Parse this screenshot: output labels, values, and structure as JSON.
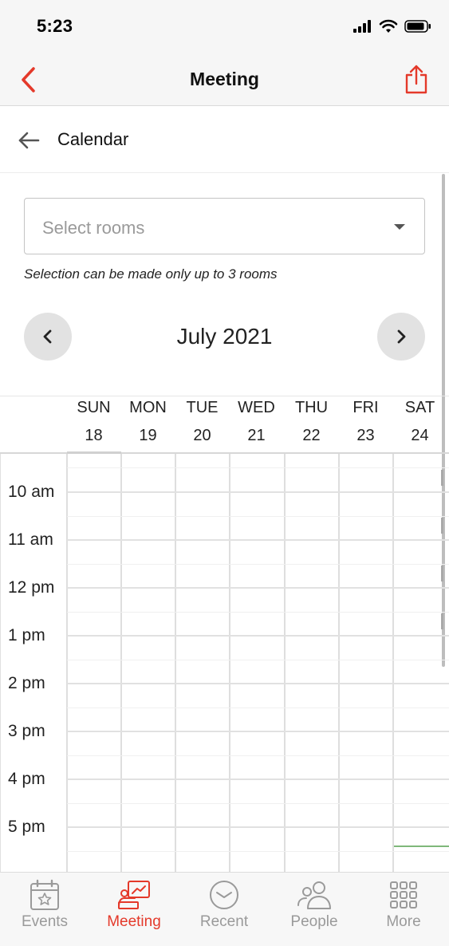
{
  "status_bar": {
    "time": "5:23"
  },
  "nav": {
    "title": "Meeting"
  },
  "sub_header": {
    "title": "Calendar"
  },
  "room_select": {
    "placeholder": "Select rooms",
    "hint": "Selection can be made only up to 3 rooms"
  },
  "calendar": {
    "month_label": "July 2021",
    "days": [
      {
        "name": "SUN",
        "num": "18"
      },
      {
        "name": "MON",
        "num": "19"
      },
      {
        "name": "TUE",
        "num": "20"
      },
      {
        "name": "WED",
        "num": "21"
      },
      {
        "name": "THU",
        "num": "22"
      },
      {
        "name": "FRI",
        "num": "23"
      },
      {
        "name": "SAT",
        "num": "24"
      }
    ],
    "hours": [
      "10 am",
      "11 am",
      "12 pm",
      "1 pm",
      "2 pm",
      "3 pm",
      "4 pm",
      "5 pm"
    ]
  },
  "tabs": [
    {
      "label": "Events",
      "icon": "calendar-star-icon",
      "active": false
    },
    {
      "label": "Meeting",
      "icon": "presentation-icon",
      "active": true
    },
    {
      "label": "Recent",
      "icon": "clock-icon",
      "active": false
    },
    {
      "label": "People",
      "icon": "people-icon",
      "active": false
    },
    {
      "label": "More",
      "icon": "grid-icon",
      "active": false
    }
  ],
  "colors": {
    "accent": "#e4392a",
    "tab_inactive": "#9a9a9a",
    "now_indicator": "#7fb87a"
  }
}
